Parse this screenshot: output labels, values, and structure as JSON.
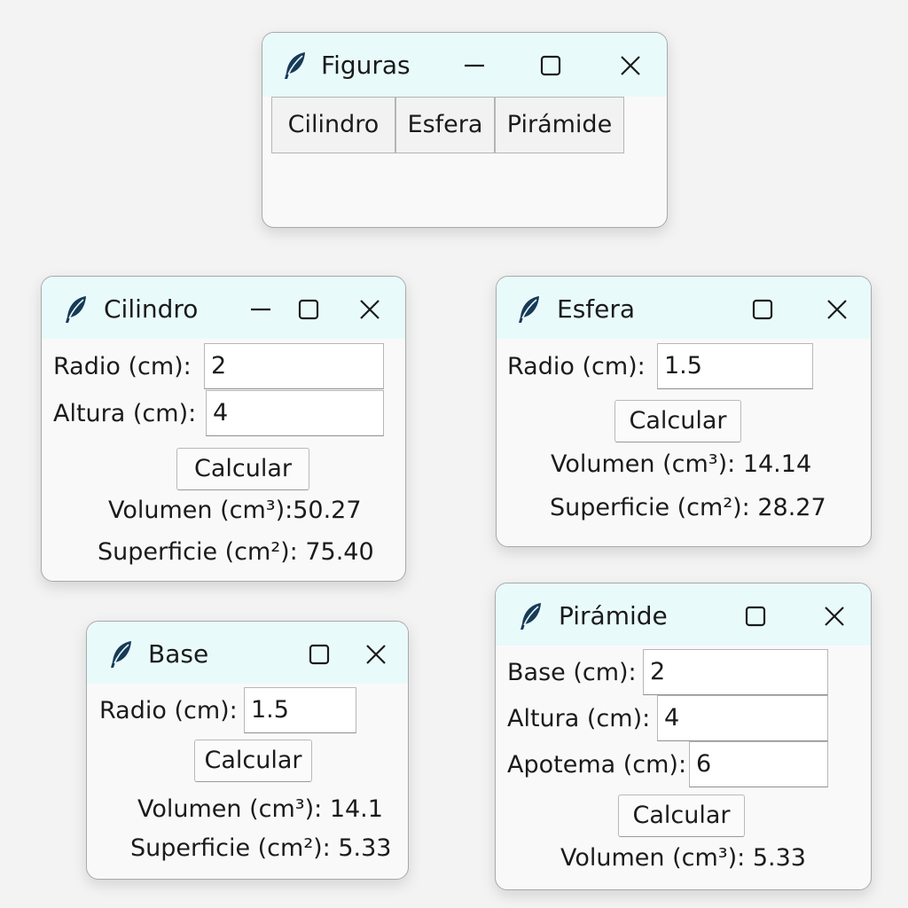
{
  "colors": {
    "titlebar": "#e9fafb",
    "window_bg": "#f9f9f9",
    "feather": "#173a57"
  },
  "icons": [
    "feather-icon",
    "minimize-icon",
    "maximize-icon",
    "close-icon"
  ],
  "figuras": {
    "title": "Figuras",
    "buttons": [
      "Cilindro",
      "Esfera",
      "Pirámide"
    ]
  },
  "cilindro": {
    "title": "Cilindro",
    "radio_label": "Radio (cm):",
    "radio_value": "2",
    "altura_label": "Altura (cm):",
    "altura_value": "4",
    "calcular": "Calcular",
    "volumen": "Volumen (cm³):50.27",
    "superficie": "Superficie (cm²): 75.40"
  },
  "esfera": {
    "title": "Esfera",
    "radio_label": "Radio (cm):",
    "radio_value": "1.5",
    "calcular": "Calcular",
    "volumen": "Volumen (cm³): 14.14",
    "superficie": "Superficie (cm²): 28.27"
  },
  "base": {
    "title": "Base",
    "radio_label": "Radio (cm):",
    "radio_value": "1.5",
    "calcular": "Calcular",
    "volumen": "Volumen (cm³): 14.1",
    "superficie": "Superficie (cm²): 5.33"
  },
  "piramide": {
    "title": "Pirámide",
    "base_label": "Base (cm):",
    "base_value": "2",
    "altura_label": "Altura (cm):",
    "altura_value": "4",
    "apotema_label": "Apotema (cm):",
    "apotema_value": "6",
    "calcular": "Calcular",
    "volumen": "Volumen (cm³): 5.33"
  }
}
